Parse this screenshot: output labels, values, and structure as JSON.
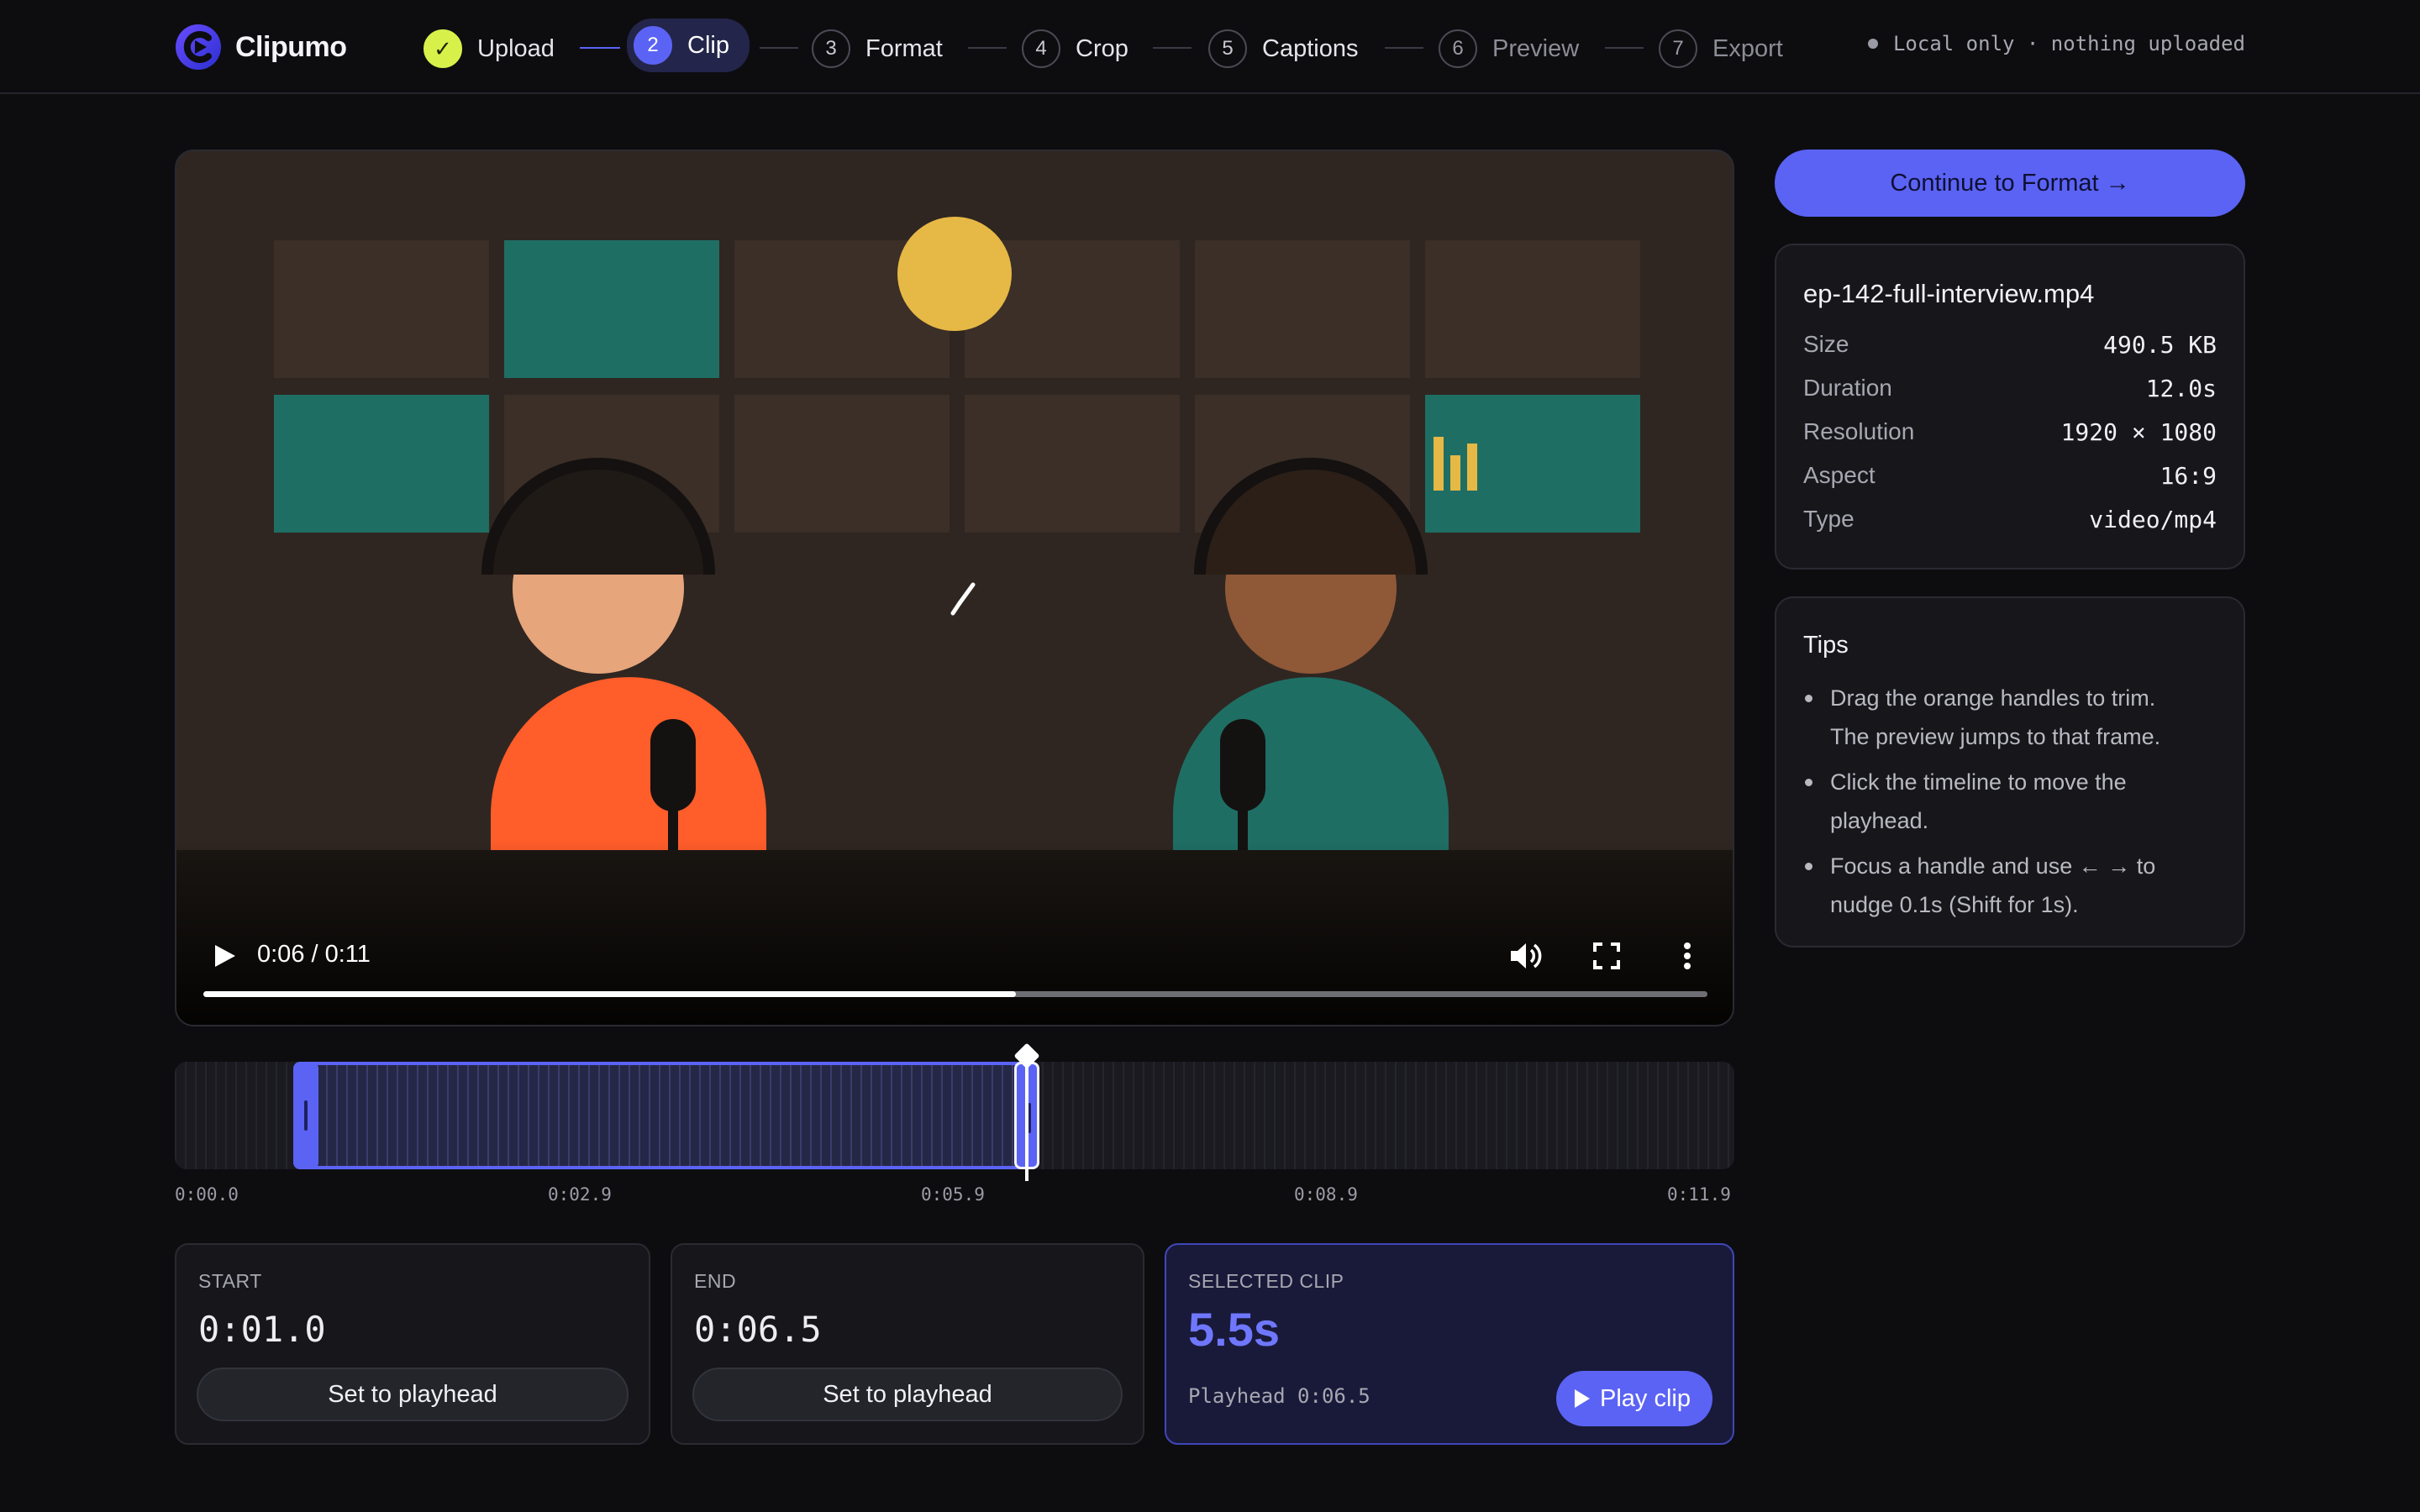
{
  "app": {
    "name": "Clipumo"
  },
  "steps": [
    {
      "num": "✓",
      "label": "Upload",
      "state": "done"
    },
    {
      "num": "2",
      "label": "Clip",
      "state": "active"
    },
    {
      "num": "3",
      "label": "Format",
      "state": "next"
    },
    {
      "num": "4",
      "label": "Crop",
      "state": "next"
    },
    {
      "num": "5",
      "label": "Captions",
      "state": "next"
    },
    {
      "num": "6",
      "label": "Preview",
      "state": "future"
    },
    {
      "num": "7",
      "label": "Export",
      "state": "future"
    }
  ],
  "privacy_note": "Local only · nothing uploaded",
  "video": {
    "time_display": "0:06 / 0:11",
    "progress_fraction": 0.54,
    "icons": [
      "play-icon",
      "volume-icon",
      "fullscreen-icon",
      "more-vert-icon"
    ]
  },
  "timeline": {
    "duration_seconds": 11.9,
    "start_seconds": 1.0,
    "end_seconds": 6.5,
    "playhead_seconds": 6.5,
    "ticks": [
      "0:00.0",
      "0:02.9",
      "0:05.9",
      "0:08.9",
      "0:11.9"
    ]
  },
  "start_card": {
    "caption": "START",
    "value": "0:01.0",
    "button": "Set to playhead"
  },
  "end_card": {
    "caption": "END",
    "value": "0:06.5",
    "button": "Set to playhead"
  },
  "selection_card": {
    "caption": "SELECTED CLIP",
    "value": "5.5s",
    "playhead_text": "Playhead 0:06.5",
    "play_button": "Play clip"
  },
  "continue_button": "Continue to Format →",
  "file": {
    "name": "ep-142-full-interview.mp4",
    "rows": [
      {
        "key": "Size",
        "value": "490.5 KB"
      },
      {
        "key": "Duration",
        "value": "12.0s"
      },
      {
        "key": "Resolution",
        "value": "1920 × 1080"
      },
      {
        "key": "Aspect",
        "value": "16:9"
      },
      {
        "key": "Type",
        "value": "video/mp4"
      }
    ]
  },
  "tips": {
    "title": "Tips",
    "items": [
      "Drag the orange handles to trim. The preview jumps to that frame.",
      "Click the timeline to move the playhead.",
      "Focus a handle and use ← → to nudge 0.1s (Shift for 1s)."
    ]
  },
  "colors": {
    "accent": "#5b63f5",
    "done_step": "#d7f14a",
    "background": "#0d0d10",
    "scene_orange": "#ff5d2a",
    "scene_teal": "#1f6e64",
    "scene_sun": "#e6b845"
  }
}
